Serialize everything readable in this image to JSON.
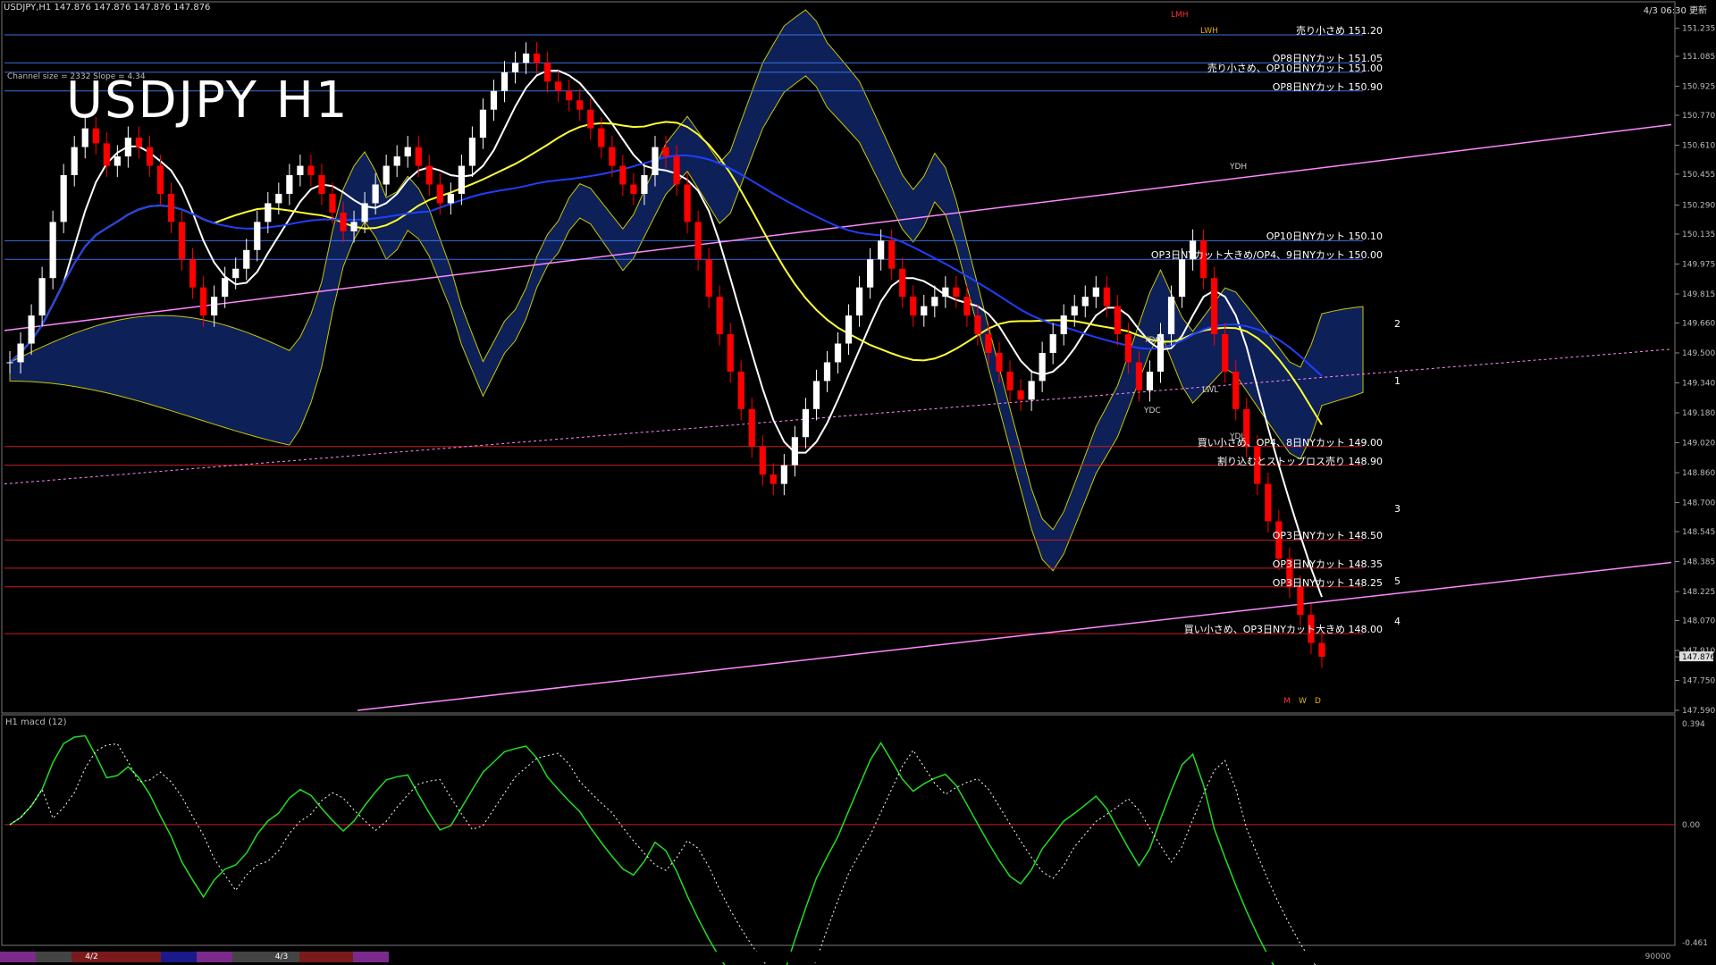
{
  "header": {
    "symbol_line": "USDJPY,H1  147.876 147.876 147.876 147.876",
    "updated": "4/3 06:30 更新",
    "chart_title": "USDJPY H1",
    "channel_info": "Channel size = 2332 Slope = 4.34",
    "macd_label": "H1  macd (12)"
  },
  "colors": {
    "background": "#000000",
    "bull_candle": "#ffffff",
    "bear_candle": "#ff0000",
    "ma_white": "#ffffff",
    "ma_yellow": "#ffff33",
    "ma_blue": "#1f3fff",
    "channel_pink": "#ff88ff",
    "level_red": "#c81e1e",
    "level_blue": "#3a6fe0",
    "cloud_blue": "#1a3aa0",
    "cloud_orange": "#b45a1e",
    "macd_green": "#22dd22",
    "macd_pink": "#ff88cc"
  },
  "chart_data": [
    {
      "type": "line",
      "title": "USDJPY H1",
      "symbol": "USDJPY",
      "timeframe": "H1",
      "last_price": 147.876,
      "ylim": [
        147.59,
        151.3
      ],
      "yticks": [
        "151.235",
        "151.085",
        "150.925",
        "150.770",
        "150.610",
        "150.455",
        "150.290",
        "150.135",
        "149.975",
        "149.815",
        "149.660",
        "149.500",
        "149.340",
        "149.180",
        "149.020",
        "148.860",
        "148.700",
        "148.545",
        "148.385",
        "148.225",
        "148.070",
        "147.910",
        "147.876",
        "147.750",
        "147.590"
      ],
      "close": [
        149.45,
        149.55,
        149.7,
        149.9,
        150.2,
        150.45,
        150.6,
        150.7,
        150.62,
        150.5,
        150.55,
        150.65,
        150.6,
        150.5,
        150.35,
        150.2,
        150.0,
        149.85,
        149.7,
        149.8,
        149.9,
        149.95,
        150.05,
        150.2,
        150.3,
        150.35,
        150.45,
        150.5,
        150.45,
        150.35,
        150.25,
        150.15,
        150.2,
        150.3,
        150.4,
        150.5,
        150.55,
        150.6,
        150.5,
        150.4,
        150.3,
        150.35,
        150.5,
        150.65,
        150.8,
        150.9,
        151.0,
        151.05,
        151.1,
        151.05,
        150.95,
        150.9,
        150.85,
        150.8,
        150.7,
        150.6,
        150.5,
        150.4,
        150.35,
        150.45,
        150.6,
        150.55,
        150.4,
        150.2,
        150.0,
        149.8,
        149.6,
        149.4,
        149.2,
        149.0,
        148.85,
        148.8,
        148.9,
        149.05,
        149.2,
        149.35,
        149.45,
        149.55,
        149.7,
        149.85,
        150.0,
        150.1,
        149.95,
        149.8,
        149.7,
        149.75,
        149.8,
        149.85,
        149.8,
        149.7,
        149.6,
        149.5,
        149.4,
        149.3,
        149.25,
        149.35,
        149.5,
        149.6,
        149.7,
        149.75,
        149.8,
        149.85,
        149.75,
        149.6,
        149.45,
        149.3,
        149.4,
        149.6,
        149.8,
        150.0,
        150.1,
        149.9,
        149.6,
        149.4,
        149.2,
        149.0,
        148.8,
        148.6,
        148.4,
        148.25,
        148.1,
        147.95,
        147.876
      ],
      "series": [
        {
          "name": "Green line",
          "color": "#22bb22"
        }
      ],
      "horizontal_levels": [
        {
          "label": "売り小さめ 151.20",
          "price": 151.2,
          "color": "#3a6fe0"
        },
        {
          "label": "OP8日NYカット 151.05",
          "price": 151.05,
          "color": "#3a6fe0"
        },
        {
          "label": "売り小さめ、OP10日NYカット 151.00",
          "price": 151.0,
          "color": "#3a6fe0"
        },
        {
          "label": "OP8日NYカット 150.90",
          "price": 150.9,
          "color": "#3a6fe0"
        },
        {
          "label": "OP10日NYカット 150.10",
          "price": 150.1,
          "color": "#3a6fe0"
        },
        {
          "label": "OP3日NYカット大きめ/OP4、9日NYカット 150.00",
          "price": 150.0,
          "color": "#3a6fe0"
        },
        {
          "label": "買い小さめ、OP4、8日NYカット 149.00",
          "price": 149.0,
          "color": "#c81e1e"
        },
        {
          "label": "割り込むとストップロス売り 148.90",
          "price": 148.9,
          "color": "#c81e1e"
        },
        {
          "label": "OP3日NYカット 148.50",
          "price": 148.5,
          "color": "#c81e1e"
        },
        {
          "label": "OP3日NYカット 148.35",
          "price": 148.35,
          "color": "#c81e1e"
        },
        {
          "label": "OP3日NYカット 148.25",
          "price": 148.25,
          "color": "#c81e1e"
        },
        {
          "label": "買い小さめ、OP3日NYカット大きめ 148.00",
          "price": 148.0,
          "color": "#c81e1e"
        }
      ],
      "pivot_tags": [
        "LMH",
        "LWH",
        "YDH",
        "YDO",
        "YDC",
        "LWL",
        "YDL",
        "M",
        "W",
        "D"
      ],
      "projection_numbers": [
        "2",
        "1",
        "3",
        "5",
        "4"
      ]
    },
    {
      "type": "line",
      "title": "",
      "indicator": "macd (12)",
      "ylim": [
        -0.461,
        0.394
      ],
      "yticks": [
        "0.394",
        "0.00",
        "-0.461"
      ]
    }
  ],
  "bottom_bar": {
    "date_labels": [
      "4/2",
      "4/3"
    ],
    "volume": "90000"
  }
}
